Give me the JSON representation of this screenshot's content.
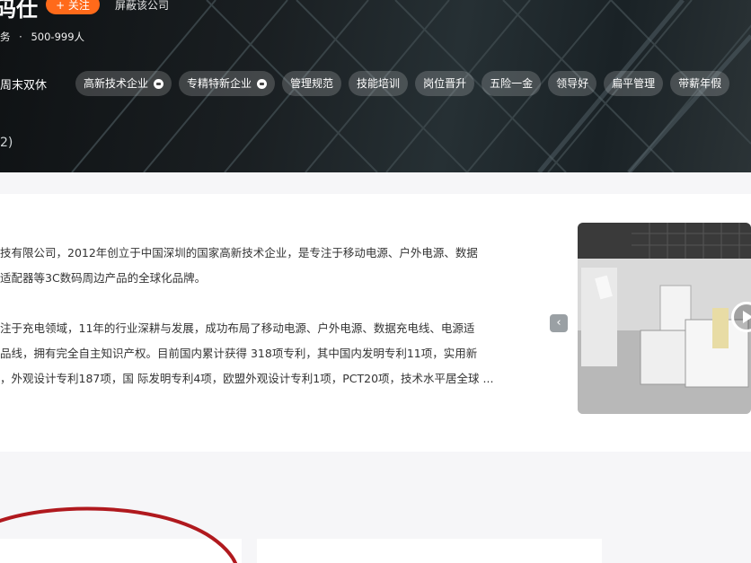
{
  "header": {
    "company_name": "码仕",
    "follow_label": "+ 关注",
    "block_label": "屏蔽该公司",
    "industry": "务",
    "size": "500-999人",
    "separator": "·",
    "benefits_first": "周末双休",
    "tags": [
      {
        "label": "高新技术企业",
        "badge": true
      },
      {
        "label": "专精特新企业",
        "badge": true
      },
      {
        "label": "管理规范",
        "badge": false
      },
      {
        "label": "技能培训",
        "badge": false
      },
      {
        "label": "岗位晋升",
        "badge": false
      },
      {
        "label": "五险一金",
        "badge": false
      },
      {
        "label": "领导好",
        "badge": false
      },
      {
        "label": "扁平管理",
        "badge": false
      },
      {
        "label": "带薪年假",
        "badge": false
      }
    ],
    "photo_count": "2)"
  },
  "intro": {
    "line1": "技有限公司，2012年创立于中国深圳的国家高新技术企业，是专注于移动电源、户外电源、数据",
    "line2": "适配器等3C数码周边产品的全球化品牌。",
    "line3": "注于充电领域，11年的行业深耕与发展，成功布局了移动电源、户外电源、数据充电线、电源适",
    "line4": "品线，拥有完全自主知识产权。目前国内累计获得 318项专利，其中国内发明专利11项，实用新",
    "line5": "，外观设计专利187项，国 际发明专利4项，欧盟外观设计专利1项，PCT20项，技术水平居全球 ..."
  },
  "media": {
    "prev_icon": "chevron-left-icon",
    "play_icon": "play-icon"
  },
  "colors": {
    "accent": "#ff6a1a",
    "annotation": "#b0191e"
  }
}
